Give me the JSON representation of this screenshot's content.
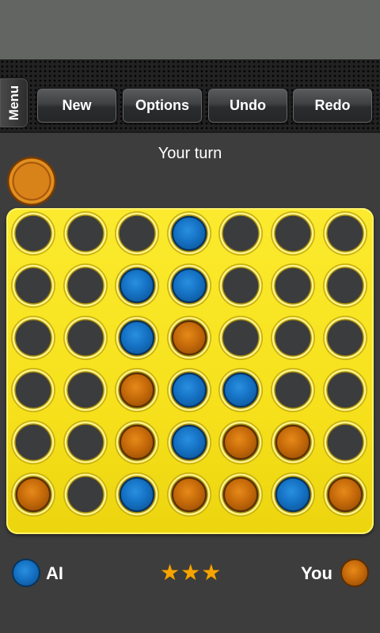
{
  "toolbar": {
    "menu_label": "Menu",
    "buttons": [
      "New",
      "Options",
      "Undo",
      "Redo"
    ]
  },
  "status": {
    "turn_text": "Your turn",
    "current_player_color": "orange"
  },
  "board": {
    "columns": 7,
    "rows": 6,
    "grid": [
      [
        "empty",
        "empty",
        "empty",
        "blue",
        "empty",
        "empty",
        "empty"
      ],
      [
        "empty",
        "empty",
        "blue",
        "blue",
        "empty",
        "empty",
        "empty"
      ],
      [
        "empty",
        "empty",
        "blue",
        "orange",
        "empty",
        "empty",
        "empty"
      ],
      [
        "empty",
        "empty",
        "orange",
        "blue",
        "blue",
        "empty",
        "empty"
      ],
      [
        "empty",
        "empty",
        "orange",
        "blue",
        "orange",
        "orange",
        "empty"
      ],
      [
        "orange",
        "empty",
        "blue",
        "orange",
        "orange",
        "blue",
        "orange"
      ]
    ]
  },
  "players": {
    "ai_label": "AI",
    "ai_color": "blue",
    "you_label": "You",
    "you_color": "orange"
  },
  "difficulty": {
    "stars": 3,
    "icon": "star-icon"
  },
  "colors": {
    "board_yellow": "#F6E11C",
    "disc_orange": "#C66A0A",
    "disc_blue": "#1572C4",
    "background": "#3D3D3D"
  }
}
